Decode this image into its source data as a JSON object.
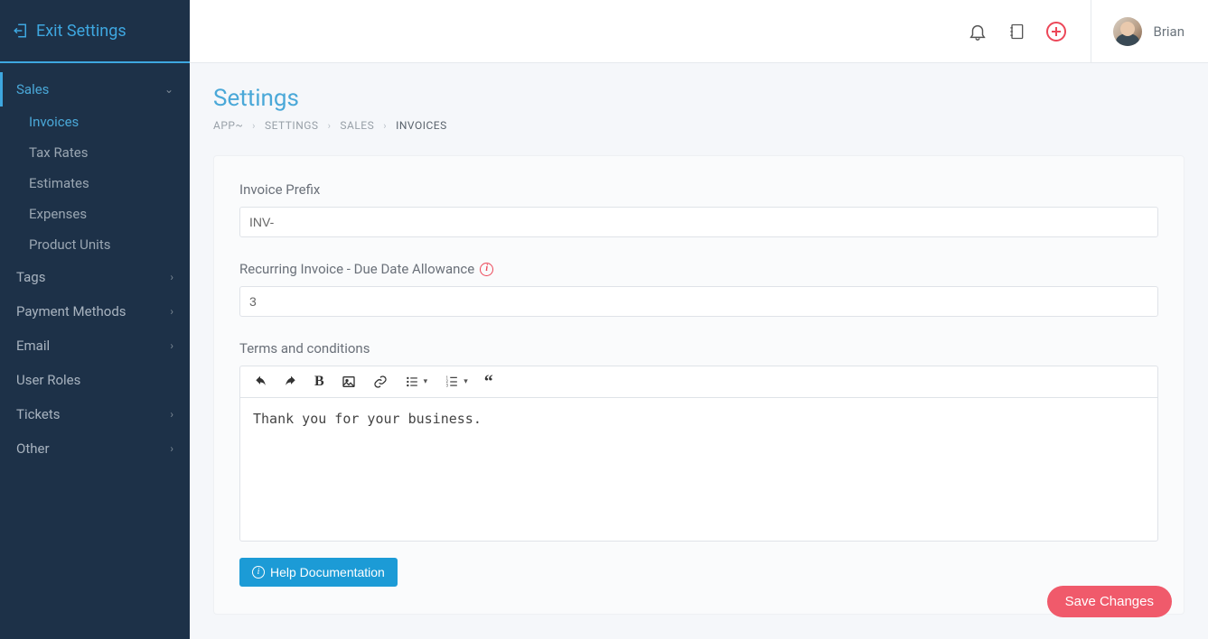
{
  "sidebar": {
    "exit_label": "Exit Settings",
    "items": [
      {
        "label": "Sales",
        "expanded": true,
        "active": true,
        "children": [
          {
            "label": "Invoices",
            "active": true
          },
          {
            "label": "Tax Rates"
          },
          {
            "label": "Estimates"
          },
          {
            "label": "Expenses"
          },
          {
            "label": "Product Units"
          }
        ]
      },
      {
        "label": "Tags",
        "expandable": true
      },
      {
        "label": "Payment Methods",
        "expandable": true
      },
      {
        "label": "Email",
        "expandable": true
      },
      {
        "label": "User Roles"
      },
      {
        "label": "Tickets",
        "expandable": true
      },
      {
        "label": "Other",
        "expandable": true
      }
    ]
  },
  "header": {
    "user_name": "Brian"
  },
  "page": {
    "title": "Settings",
    "breadcrumbs": [
      "APP~",
      "SETTINGS",
      "SALES",
      "INVOICES"
    ]
  },
  "form": {
    "invoice_prefix": {
      "label": "Invoice Prefix",
      "value": "INV-"
    },
    "due_date_allowance": {
      "label": "Recurring Invoice - Due Date Allowance",
      "value": "3"
    },
    "terms": {
      "label": "Terms and conditions",
      "value": "Thank you for your business."
    },
    "help_button": "Help Documentation",
    "save_button": "Save Changes"
  }
}
